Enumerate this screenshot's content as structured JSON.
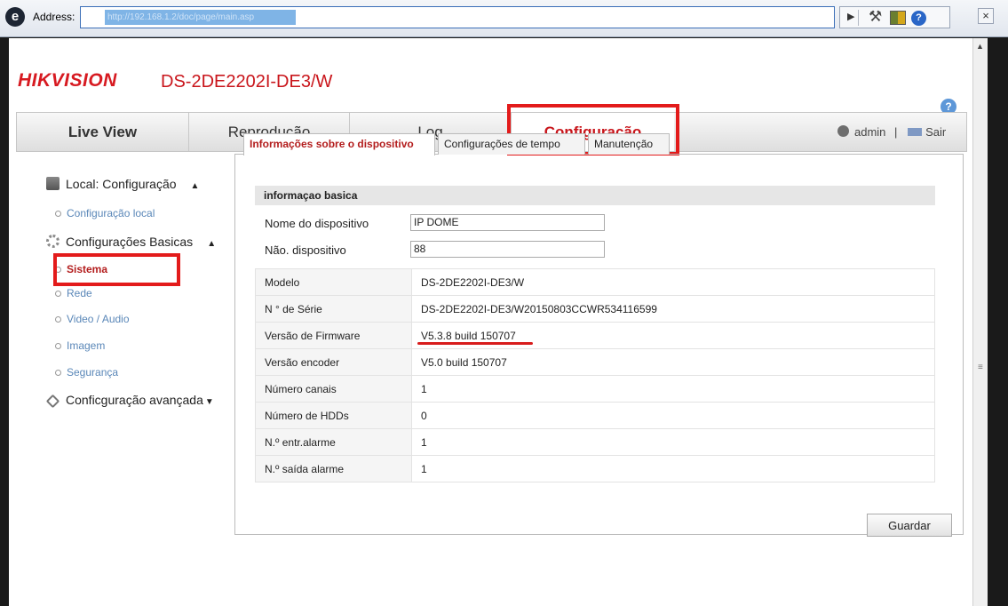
{
  "browser": {
    "address_label": "Address:",
    "address_value": "http://192.168.1.2/doc/page/main.asp",
    "close_glyph": "×"
  },
  "header": {
    "brand": "HIKVISION",
    "model": "DS-2DE2202I-DE3/W",
    "help_glyph": "?"
  },
  "nav": {
    "tabs": [
      {
        "label": "Live View"
      },
      {
        "label": "Reprodução"
      },
      {
        "label": "Log"
      },
      {
        "label": "Configuração",
        "active": true
      }
    ],
    "user": "admin",
    "separator": "|",
    "logout": "Sair"
  },
  "sidebar": {
    "local_header": "Local: Configuração",
    "local_items": [
      "Configuração local"
    ],
    "basic_header": "Configurações Basicas",
    "basic_items": [
      "Sistema",
      "Rede",
      "Video / Audio",
      "Imagem",
      "Segurança"
    ],
    "advanced_header": "Conficguração avançada"
  },
  "subtabs": [
    "Informações sobre o dispositivo",
    "Configurações de tempo",
    "Manutenção"
  ],
  "form": {
    "section_title": "informaçao basica",
    "device_name_label": "Nome do dispositivo",
    "device_name_value": "IP DOME",
    "device_no_label": "Não. dispositivo",
    "device_no_value": "88"
  },
  "info_rows": [
    {
      "label": "Modelo",
      "value": "DS-2DE2202I-DE3/W"
    },
    {
      "label": "N ° de Série",
      "value": "DS-2DE2202I-DE3/W20150803CCWR534116599"
    },
    {
      "label": "Versão de Firmware",
      "value": "V5.3.8 build 150707"
    },
    {
      "label": "Versão encoder",
      "value": "V5.0 build 150707"
    },
    {
      "label": "Número canais",
      "value": "1"
    },
    {
      "label": "Número de HDDs",
      "value": "0"
    },
    {
      "label": "N.º entr.alarme",
      "value": "1"
    },
    {
      "label": "N.º saída alarme",
      "value": "1"
    }
  ],
  "actions": {
    "save": "Guardar"
  },
  "colors": {
    "accent_red": "#c8151b",
    "highlight_red": "#e31b1b",
    "link_blue": "#5a87b8"
  }
}
